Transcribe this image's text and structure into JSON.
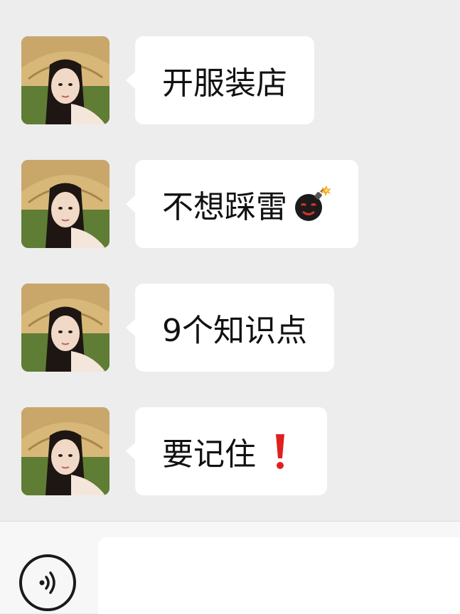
{
  "colors": {
    "chat_background": "#ededed",
    "bubble_background": "#ffffff",
    "input_bar_background": "#f7f7f7",
    "text": "#111111",
    "exclamation_red": "#e02020"
  },
  "messages": [
    {
      "text": "开服装店",
      "emoji": null
    },
    {
      "text": "不想踩雷",
      "emoji": "bomb-emoji"
    },
    {
      "text": "9个知识点",
      "emoji": null
    },
    {
      "text": "要记住",
      "emoji": "red-exclamation-emoji"
    }
  ],
  "input_bar": {
    "voice_icon": "voice-waves-icon",
    "text_value": "",
    "placeholder": ""
  }
}
